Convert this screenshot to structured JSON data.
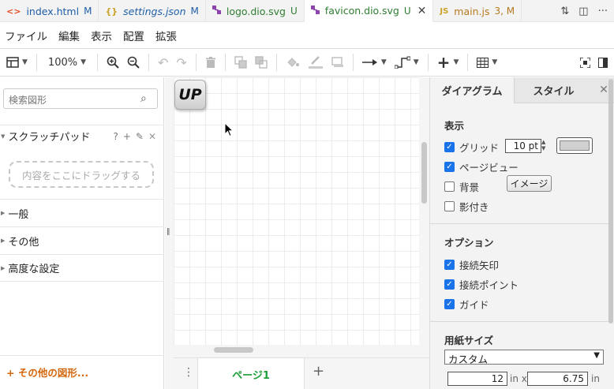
{
  "tabs": [
    {
      "icon": "<>",
      "label": "index.html",
      "badge": "M",
      "color": "#1f5ea8",
      "active": false
    },
    {
      "icon": "{}",
      "label": "settings.json",
      "badge": "M",
      "color": "#1f5ea8",
      "active": false
    },
    {
      "icon": "drawio",
      "label": "logo.dio.svg",
      "badge": "U",
      "color": "#2e7d32",
      "active": false
    },
    {
      "icon": "drawio",
      "label": "favicon.dio.svg",
      "badge": "U",
      "color": "#2e7d32",
      "active": true
    },
    {
      "icon": "JS",
      "label": "main.js",
      "badge": "3, M",
      "color": "#b7791f",
      "active": false
    }
  ],
  "menu": [
    "ファイル",
    "編集",
    "表示",
    "配置",
    "拡張"
  ],
  "toolbar": {
    "zoom": "100%"
  },
  "sidebar": {
    "search_placeholder": "検索図形",
    "scratchpad_title": "スクラッチパッド",
    "scratchpad_help": "?",
    "dropzone": "内容をここにドラッグする",
    "sections": [
      "一般",
      "その他",
      "高度な設定"
    ],
    "more_shapes": "+ その他の図形..."
  },
  "canvas": {
    "shape_text": "UP"
  },
  "pages": {
    "current": "ページ1"
  },
  "format_panel": {
    "tabs": [
      "ダイアグラム",
      "スタイル"
    ],
    "view_title": "表示",
    "grid_label": "グリッド",
    "grid_size": "10 pt",
    "grid_color": "#d0d0d0",
    "page_view_label": "ページビュー",
    "background_label": "背景",
    "image_button": "イメージ",
    "shadow_label": "影付き",
    "options_title": "オプション",
    "connection_arrows": "接続矢印",
    "connection_points": "接続ポイント",
    "guides": "ガイド",
    "paper_size_title": "用紙サイズ",
    "paper_size_value": "カスタム",
    "width": "12",
    "height": "6.75",
    "unit_x": "in x",
    "unit_in": "in",
    "checks": {
      "grid": true,
      "page_view": true,
      "background": false,
      "shadow": false,
      "connection_arrows": true,
      "connection_points": true,
      "guides": true
    }
  }
}
